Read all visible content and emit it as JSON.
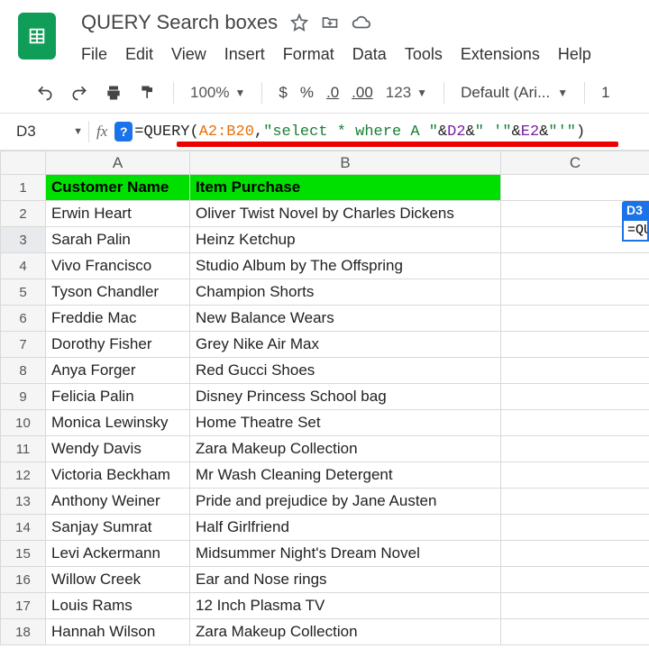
{
  "doc": {
    "title": "QUERY Search boxes"
  },
  "menu": {
    "file": "File",
    "edit": "Edit",
    "view": "View",
    "insert": "Insert",
    "format": "Format",
    "data": "Data",
    "tools": "Tools",
    "extensions": "Extensions",
    "help": "Help"
  },
  "toolbar": {
    "zoom": "100%",
    "currency": "$",
    "percent": "%",
    "decdec": ".0",
    "incdec": ".00",
    "numfmt": "123",
    "font": "Default (Ari...",
    "fontsize": "1"
  },
  "formula": {
    "cellref": "D3",
    "prefix": "=QUERY(",
    "range": "A2:B20",
    "comma": ",",
    "str1": "\"select * where A \"",
    "amp1": "&",
    "ref1": "D2",
    "amp2": "&",
    "str2": "\" '\"",
    "amp3": "&",
    "ref2": "E2",
    "amp4": "&",
    "str3": "\"'\"",
    "suffix": ")"
  },
  "overlay": {
    "label": "D3",
    "text": "=QU"
  },
  "columns": {
    "A": "A",
    "B": "B",
    "C": "C"
  },
  "headerrow": {
    "A": "Customer Name",
    "B": "Item Purchase"
  },
  "rows": [
    {
      "n": "2",
      "A": "Erwin Heart",
      "B": "Oliver Twist Novel by Charles Dickens"
    },
    {
      "n": "3",
      "A": "Sarah Palin",
      "B": "Heinz Ketchup"
    },
    {
      "n": "4",
      "A": "Vivo Francisco",
      "B": "Studio Album by The Offspring"
    },
    {
      "n": "5",
      "A": "Tyson Chandler",
      "B": "Champion Shorts"
    },
    {
      "n": "6",
      "A": "Freddie Mac",
      "B": "New Balance Wears"
    },
    {
      "n": "7",
      "A": "Dorothy Fisher",
      "B": "Grey Nike Air Max"
    },
    {
      "n": "8",
      "A": "Anya Forger",
      "B": "Red Gucci Shoes"
    },
    {
      "n": "9",
      "A": "Felicia Palin",
      "B": "Disney Princess School bag"
    },
    {
      "n": "10",
      "A": "Monica Lewinsky",
      "B": "Home Theatre Set"
    },
    {
      "n": "11",
      "A": "Wendy Davis",
      "B": "Zara Makeup Collection"
    },
    {
      "n": "12",
      "A": "Victoria Beckham",
      "B": "Mr Wash Cleaning Detergent"
    },
    {
      "n": "13",
      "A": "Anthony Weiner",
      "B": "Pride and prejudice by Jane Austen"
    },
    {
      "n": "14",
      "A": "Sanjay Sumrat",
      "B": "Half Girlfriend"
    },
    {
      "n": "15",
      "A": "Levi Ackermann",
      "B": "Midsummer Night's Dream Novel"
    },
    {
      "n": "16",
      "A": "Willow Creek",
      "B": "Ear and Nose rings"
    },
    {
      "n": "17",
      "A": "Louis Rams",
      "B": "12 Inch Plasma TV"
    },
    {
      "n": "18",
      "A": "Hannah Wilson",
      "B": "Zara Makeup Collection"
    }
  ]
}
